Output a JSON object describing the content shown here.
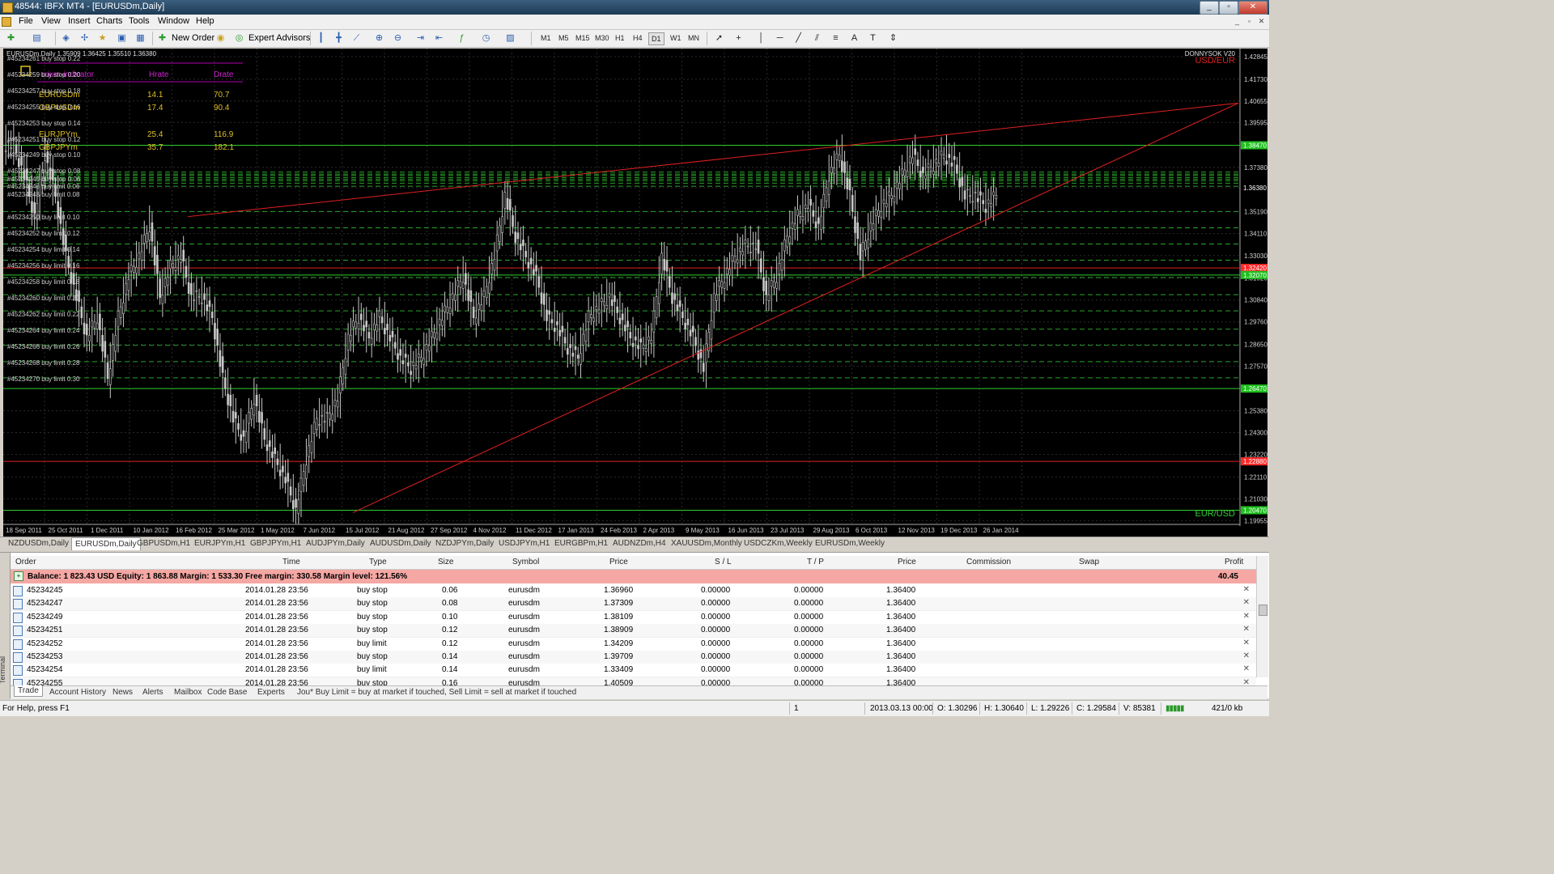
{
  "window": {
    "title": "48544: IBFX MT4 - [EURUSDm,Daily]"
  },
  "menu": [
    "File",
    "View",
    "Insert",
    "Charts",
    "Tools",
    "Window",
    "Help"
  ],
  "toolbar": {
    "new_order": "New Order",
    "expert_advisors": "Expert Advisors",
    "timeframes": [
      "M1",
      "M5",
      "M15",
      "M30",
      "H1",
      "H4",
      "D1",
      "W1",
      "MN"
    ],
    "active_timeframe": "D1"
  },
  "chart": {
    "header": "EURUSDm,Daily  1.35909 1.36425 1.35510 1.36380",
    "watermark": "DONNYSOK V20",
    "pair_label_top": "USD/EUR",
    "pair_label_bottom": "EUR/USD",
    "indicator": {
      "headers": [
        "urium-indicator",
        "Hrate",
        "Drate"
      ],
      "rows": [
        {
          "symbol": "EURUSDm",
          "hrate": "14.1",
          "drate": "70.7"
        },
        {
          "symbol": "GBPUSDm",
          "hrate": "17.4",
          "drate": "90.4"
        },
        {
          "symbol": "EURJPYm",
          "hrate": "25.4",
          "drate": "116.9"
        },
        {
          "symbol": "GBPJPYm",
          "hrate": "35.7",
          "drate": "182.1"
        }
      ]
    },
    "order_labels": [
      "#45234261 buy stop 0.22",
      "#45234259 buy stop 0.20",
      "#45234257 buy stop 0.18",
      "#45234255 buy stop 0.16",
      "#45234253 buy stop 0.14",
      "#45234251 buy stop 0.12",
      "#45234249 buy stop 0.10",
      "#45234247 buy stop 0.08",
      "#45234245 buy stop 0.06",
      "#45234246 buy limit 0.06",
      "#45234248 buy limit 0.08",
      "#45234250 buy limit 0.10",
      "#45234252 buy limit 0.12",
      "#45234254 buy limit 0.14",
      "#45234256 buy limit 0.16",
      "#45234258 buy limit 0.18",
      "#45234260 buy limit 0.20",
      "#45234262 buy limit 0.22",
      "#45234264 buy limit 0.24",
      "#45234266 buy limit 0.26",
      "#45234268 buy limit 0.28",
      "#45234270 buy limit 0.30"
    ],
    "price_axis": [
      "1.42845",
      "1.41730",
      "1.40655",
      "1.39595",
      "1.38470",
      "1.37380",
      "1.36380",
      "1.35190",
      "1.34110",
      "1.33030",
      "1.31920",
      "1.30840",
      "1.29760",
      "1.28650",
      "1.27570",
      "1.26470",
      "1.25380",
      "1.24300",
      "1.23220",
      "1.22110",
      "1.21030",
      "1.19955"
    ],
    "price_tags": [
      {
        "value": "1.38470",
        "color": "#1fbf1f"
      },
      {
        "value": "1.36380",
        "color": "#ffffff"
      },
      {
        "value": "1.32420",
        "color": "#ff2a2a"
      },
      {
        "value": "1.32070",
        "color": "#1fbf1f"
      },
      {
        "value": "1.26470",
        "color": "#1fbf1f"
      },
      {
        "value": "1.22880",
        "color": "#ff2a2a"
      },
      {
        "value": "1.20470",
        "color": "#1fbf1f"
      }
    ],
    "time_axis": [
      "18 Sep 2011",
      "25 Oct 2011",
      "1 Dec 2011",
      "10 Jan 2012",
      "16 Feb 2012",
      "25 Mar 2012",
      "1 May 2012",
      "7 Jun 2012",
      "15 Jul 2012",
      "21 Aug 2012",
      "27 Sep 2012",
      "4 Nov 2012",
      "11 Dec 2012",
      "17 Jan 2013",
      "24 Feb 2013",
      "2 Apr 2013",
      "9 May 2013",
      "16 Jun 2013",
      "23 Jul 2013",
      "29 Aug 2013",
      "6 Oct 2013",
      "12 Nov 2013",
      "19 Dec 2013",
      "26 Jan 2014"
    ],
    "colors": {
      "background": "#000000",
      "candle": "#c8c8c8",
      "grid": "#2a2a2a",
      "orderline": "#2aa32a",
      "trendline": "#e02020",
      "support": "#2ecc2e"
    },
    "series_close": [
      1.385,
      1.37,
      1.35,
      1.38,
      1.36,
      1.33,
      1.31,
      1.29,
      1.3,
      1.27,
      1.3,
      1.32,
      1.33,
      1.345,
      1.31,
      1.325,
      1.33,
      1.31,
      1.31,
      1.3,
      1.27,
      1.25,
      1.24,
      1.26,
      1.24,
      1.23,
      1.22,
      1.205,
      1.23,
      1.25,
      1.25,
      1.26,
      1.29,
      1.3,
      1.29,
      1.3,
      1.29,
      1.28,
      1.275,
      1.28,
      1.29,
      1.3,
      1.31,
      1.32,
      1.3,
      1.31,
      1.33,
      1.36,
      1.34,
      1.33,
      1.32,
      1.3,
      1.295,
      1.285,
      1.28,
      1.3,
      1.305,
      1.31,
      1.3,
      1.29,
      1.285,
      1.29,
      1.33,
      1.31,
      1.3,
      1.29,
      1.275,
      1.31,
      1.32,
      1.33,
      1.335,
      1.335,
      1.31,
      1.32,
      1.34,
      1.35,
      1.355,
      1.345,
      1.37,
      1.38,
      1.36,
      1.33,
      1.345,
      1.355,
      1.36,
      1.37,
      1.38,
      1.37,
      1.375,
      1.38,
      1.375,
      1.36,
      1.36,
      1.355,
      1.36
    ]
  },
  "symbol_tabs": [
    "NZDUSDm,Daily",
    "EURUSDm,Daily",
    "GBPUSDm,H1",
    "EURJPYm,H1",
    "GBPJPYm,H1",
    "AUDJPYm,Daily",
    "AUDUSDm,Daily",
    "NZDJPYm,Daily",
    "USDJPYm,H1",
    "EURGBPm,H1",
    "AUDNZDm,H4",
    "XAUUSDm,Monthly",
    "USDCZKm,Weekly",
    "EURUSDm,Weekly"
  ],
  "active_symbol_tab": "EURUSDm,Daily",
  "terminal": {
    "side_label": "Terminal",
    "columns": [
      "Order",
      "Time",
      "Type",
      "Size",
      "Symbol",
      "Price",
      "S / L",
      "T / P",
      "Price",
      "Commission",
      "Swap",
      "Profit"
    ],
    "balance": {
      "text": "Balance: 1 823.43 USD  Equity: 1 863.88  Margin: 1 533.30  Free margin: 330.58  Margin level: 121.56%",
      "profit": "40.45"
    },
    "rows": [
      {
        "order": "45234245",
        "time": "2014.01.28 23:56",
        "type": "buy stop",
        "size": "0.06",
        "symbol": "eurusdm",
        "price": "1.36960",
        "sl": "0.00000",
        "tp": "0.00000",
        "cur": "1.36400"
      },
      {
        "order": "45234247",
        "time": "2014.01.28 23:56",
        "type": "buy stop",
        "size": "0.08",
        "symbol": "eurusdm",
        "price": "1.37309",
        "sl": "0.00000",
        "tp": "0.00000",
        "cur": "1.36400"
      },
      {
        "order": "45234249",
        "time": "2014.01.28 23:56",
        "type": "buy stop",
        "size": "0.10",
        "symbol": "eurusdm",
        "price": "1.38109",
        "sl": "0.00000",
        "tp": "0.00000",
        "cur": "1.36400"
      },
      {
        "order": "45234251",
        "time": "2014.01.28 23:56",
        "type": "buy stop",
        "size": "0.12",
        "symbol": "eurusdm",
        "price": "1.38909",
        "sl": "0.00000",
        "tp": "0.00000",
        "cur": "1.36400"
      },
      {
        "order": "45234252",
        "time": "2014.01.28 23:56",
        "type": "buy limit",
        "size": "0.12",
        "symbol": "eurusdm",
        "price": "1.34209",
        "sl": "0.00000",
        "tp": "0.00000",
        "cur": "1.36400"
      },
      {
        "order": "45234253",
        "time": "2014.01.28 23:56",
        "type": "buy stop",
        "size": "0.14",
        "symbol": "eurusdm",
        "price": "1.39709",
        "sl": "0.00000",
        "tp": "0.00000",
        "cur": "1.36400"
      },
      {
        "order": "45234254",
        "time": "2014.01.28 23:56",
        "type": "buy limit",
        "size": "0.14",
        "symbol": "eurusdm",
        "price": "1.33409",
        "sl": "0.00000",
        "tp": "0.00000",
        "cur": "1.36400"
      },
      {
        "order": "45234255",
        "time": "2014.01.28 23:56",
        "type": "buy stop",
        "size": "0.16",
        "symbol": "eurusdm",
        "price": "1.40509",
        "sl": "0.00000",
        "tp": "0.00000",
        "cur": "1.36400"
      }
    ],
    "bottom_tabs": [
      "Trade",
      "Account History",
      "News",
      "Alerts",
      "Mailbox",
      "Code Base",
      "Experts"
    ],
    "active_bottom_tab": "Trade",
    "hint": "Jou* Buy Limit = buy at market if touched, Sell Limit = sell at market if touched"
  },
  "status": {
    "help": "For Help, press F1",
    "profile": "1",
    "datetime": "2013.03.13 00:00",
    "open": "O: 1.30296",
    "high": "H: 1.30640",
    "low": "L: 1.29226",
    "close": "C: 1.29584",
    "volume": "V: 85381",
    "traffic": "421/0 kb"
  }
}
